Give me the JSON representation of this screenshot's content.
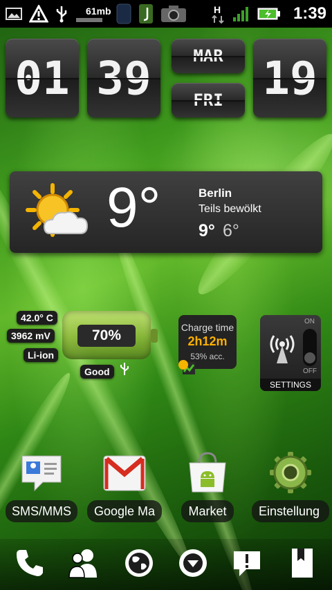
{
  "status_bar": {
    "memory": "61mb",
    "network": "H",
    "time": "1:39",
    "icons": [
      "gallery-icon",
      "warning-icon",
      "usb-icon",
      "memory-icon",
      "sim-icon",
      "app-icon",
      "camera-icon",
      "network-h-icon",
      "signal-icon",
      "battery-charging-icon"
    ]
  },
  "clock": {
    "hour": "01",
    "minute": "39",
    "month": "MAR",
    "weekday": "FRI",
    "day": "19"
  },
  "weather": {
    "temperature": "9°",
    "city": "Berlin",
    "condition": "Teils bewölkt",
    "high": "9°",
    "low": "6°",
    "icon": "partly-cloudy-icon"
  },
  "battery": {
    "temperature": "42.0° C",
    "voltage": "3962 mV",
    "type": "Li-ion",
    "percent": "70%",
    "level": 0.7,
    "health": "Good",
    "charge_label": "Charge time",
    "charge_time": "2h12m",
    "accuracy": "53% acc."
  },
  "toggle": {
    "on_label": "ON",
    "off_label": "OFF",
    "settings_label": "SETTINGS",
    "state": "off",
    "icon": "antenna-icon"
  },
  "apps": [
    {
      "label": "SMS/MMS",
      "icon": "sms-icon"
    },
    {
      "label": "Google Ma",
      "icon": "gmail-icon"
    },
    {
      "label": "Market",
      "icon": "market-icon"
    },
    {
      "label": "Einstellung",
      "icon": "settings-gear-icon"
    }
  ],
  "dock": [
    "phone-icon",
    "contacts-icon",
    "browser-icon",
    "app-drawer-icon",
    "messages-icon",
    "bookmark-icon"
  ],
  "colors": {
    "charge_time": "#ffb000",
    "wallpaper": "#3f9a1d"
  }
}
